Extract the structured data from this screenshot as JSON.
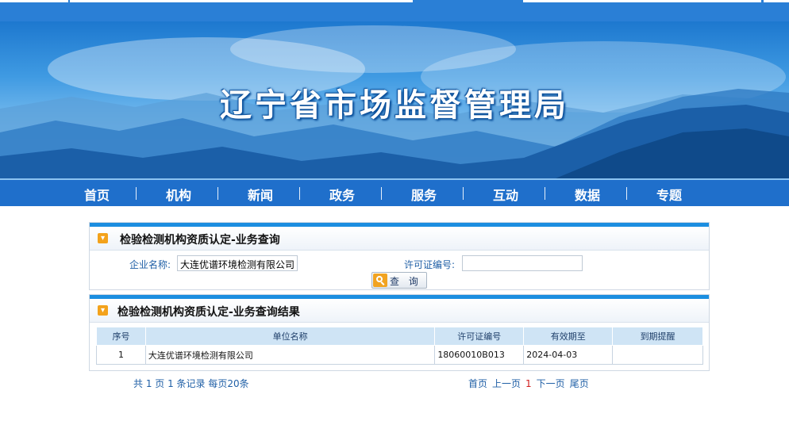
{
  "site": {
    "title": "辽宁省市场监督管理局"
  },
  "nav": [
    "首页",
    "机构",
    "新闻",
    "政务",
    "服务",
    "互动",
    "数据",
    "专题"
  ],
  "query_panel": {
    "title": "检验检测机构资质认定-业务查询",
    "company_label": "企业名称:",
    "company_value": "大连优谱环境检测有限公司",
    "license_label": "许可证编号:",
    "license_value": "",
    "search_button": "查 询"
  },
  "result_panel": {
    "title": "检验检测机构资质认定-业务查询结果",
    "columns": [
      "序号",
      "单位名称",
      "许可证编号",
      "有效期至",
      "到期提醒"
    ],
    "rows": [
      [
        "1",
        "大连优谱环境检测有限公司",
        "18060010B013",
        "2024-04-03",
        ""
      ]
    ]
  },
  "pagination": {
    "summary": "共 1 页 1 条记录 每页20条",
    "first": "首页",
    "prev": "上一页",
    "current": "1",
    "next": "下一页",
    "last": "尾页"
  },
  "colors": {
    "nav_bg": "#1f6fcb",
    "accent": "#1b8ee0",
    "icon_orange": "#f3a21b"
  }
}
